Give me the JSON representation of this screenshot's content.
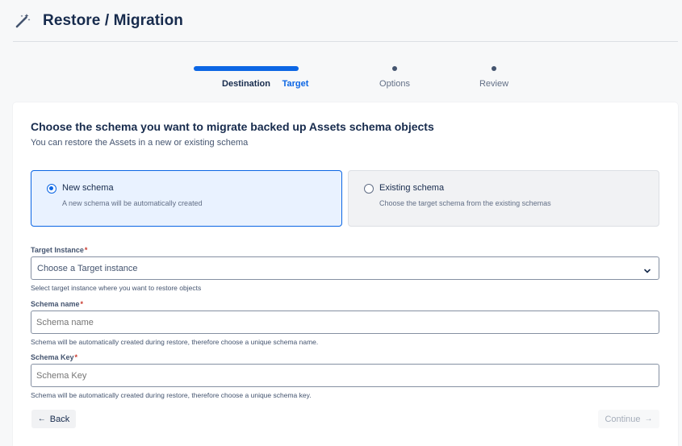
{
  "header": {
    "title": "Restore / Migration",
    "icon": "magic-wand-icon"
  },
  "stepper": {
    "steps": [
      {
        "label": "Destination",
        "state": "done"
      },
      {
        "label": "Target",
        "state": "active"
      },
      {
        "label": "Options",
        "state": "todo"
      },
      {
        "label": "Review",
        "state": "todo"
      }
    ]
  },
  "card": {
    "title": "Choose the schema you want to migrate backed up Assets schema objects",
    "subtitle": "You can restore the Assets in a new or existing schema",
    "options": [
      {
        "label": "New schema",
        "description": "A new schema will be automatically created",
        "selected": true
      },
      {
        "label": "Existing schema",
        "description": "Choose the target schema from the existing schemas",
        "selected": false
      }
    ]
  },
  "form": {
    "target_instance": {
      "label": "Target Instance",
      "required_mark": "*",
      "value": "Choose a Target instance",
      "helper": "Select target instance where you want to restore objects"
    },
    "schema_name": {
      "label": "Schema name",
      "required_mark": "*",
      "placeholder": "Schema name",
      "helper": "Schema will be automatically created during restore, therefore choose a unique schema name."
    },
    "schema_key": {
      "label": "Schema Key",
      "required_mark": "*",
      "placeholder": "Schema Key",
      "helper": "Schema will be automatically created during restore, therefore choose a unique schema key."
    }
  },
  "actions": {
    "back_label": "Back",
    "back_arrow": "←",
    "continue_label": "Continue",
    "continue_arrow": "→"
  },
  "colors": {
    "accent": "#0c66e4",
    "text": "#172b4d",
    "required": "#c9372c"
  }
}
